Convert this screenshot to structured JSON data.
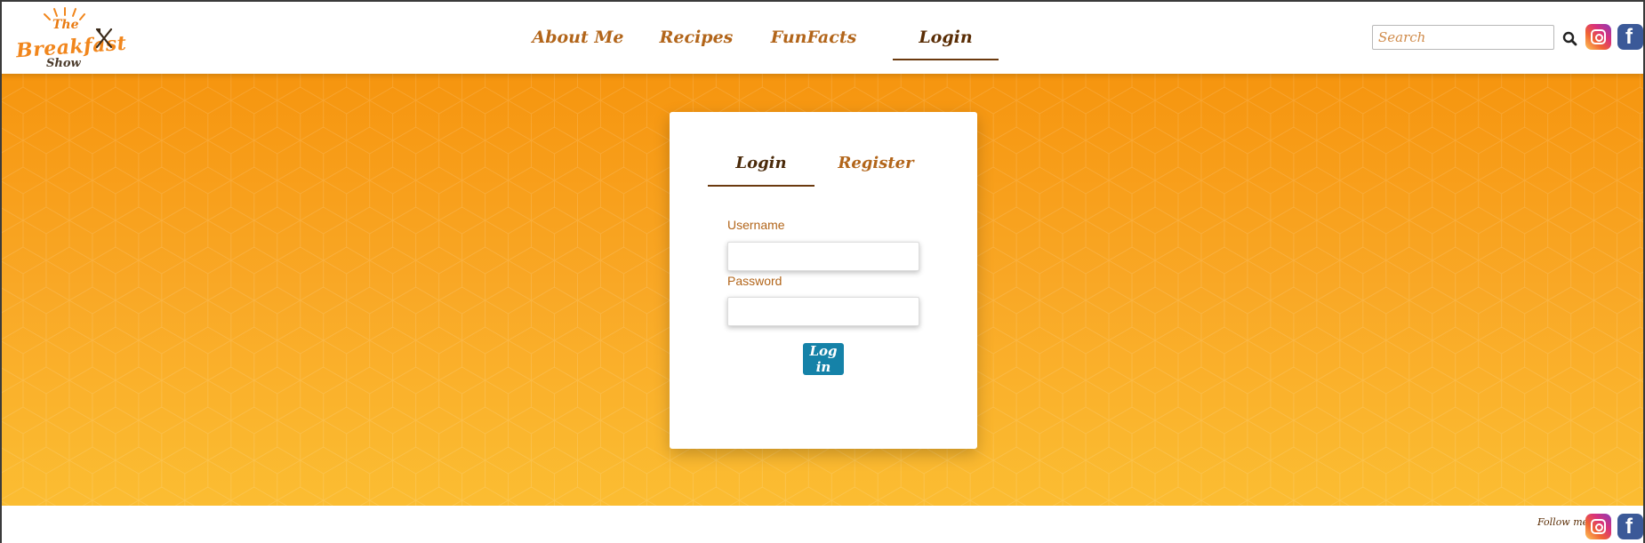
{
  "brand": {
    "logo_the": "The",
    "logo_breakfast": "Breakfast",
    "logo_show": "Show"
  },
  "nav": {
    "items": [
      {
        "label": "About Me",
        "active": false
      },
      {
        "label": "Recipes",
        "active": false
      },
      {
        "label": "FunFacts",
        "active": false
      },
      {
        "label": "Login",
        "active": true
      }
    ]
  },
  "search": {
    "placeholder": "Search",
    "value": ""
  },
  "social": {
    "instagram_icon": "instagram-icon",
    "facebook_icon": "facebook-icon",
    "facebook_letter": "f"
  },
  "auth_card": {
    "tabs": [
      {
        "label": "Login",
        "active": true
      },
      {
        "label": "Register",
        "active": false
      }
    ],
    "username_label": "Username",
    "username_value": "",
    "password_label": "Password",
    "password_value": "",
    "submit_label": "Log in"
  },
  "footer": {
    "follow_label": "Follow me"
  },
  "colors": {
    "accent_orange": "#f9a826",
    "nav_text": "#b2651a",
    "nav_active": "#5a2d05",
    "button_blue": "#1582a8"
  }
}
